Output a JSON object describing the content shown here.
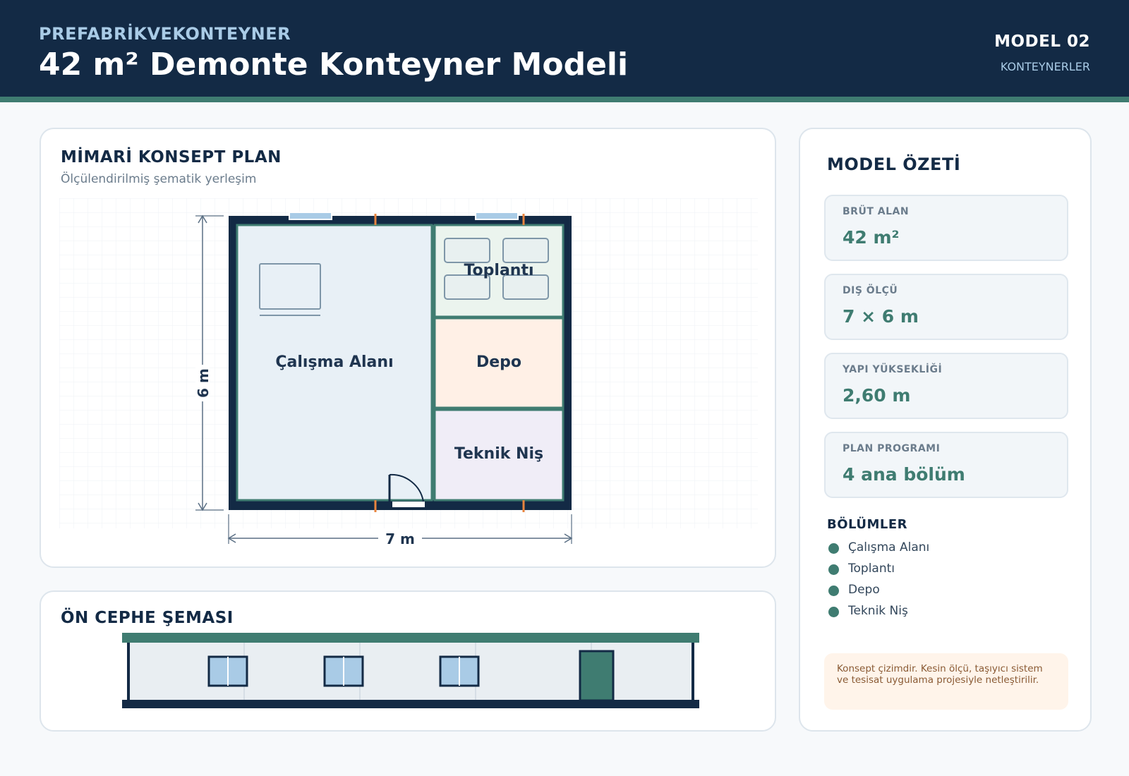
{
  "header": {
    "brand": "PREFABRİKVEKONTEYNER",
    "title": "42 m² Demonte Konteyner Modeli",
    "model_code": "MODEL 02",
    "category": "KONTEYNERLER"
  },
  "plan": {
    "title": "MİMARİ KONSEPT PLAN",
    "subtitle": "Ölçülendirilmiş şematik yerleşim",
    "width_label": "7 m",
    "height_label": "6 m",
    "rooms": {
      "work": "Çalışma Alanı",
      "meeting": "Toplantı",
      "storage": "Depo",
      "technical": "Teknik Niş"
    }
  },
  "front": {
    "title": "ÖN CEPHE ŞEMASI"
  },
  "summary": {
    "title": "MODEL ÖZETİ",
    "stats": [
      {
        "label": "BRÜT ALAN",
        "value": "42 m²"
      },
      {
        "label": "DIŞ ÖLÇÜ",
        "value": "7 × 6 m"
      },
      {
        "label": "YAPI YÜKSEKLİĞİ",
        "value": "2,60 m"
      },
      {
        "label": "PLAN PROGRAMI",
        "value": "4 ana bölüm"
      }
    ],
    "sections_title": "BÖLÜMLER",
    "sections": [
      "Çalışma Alanı",
      "Toplantı",
      "Depo",
      "Teknik Niş"
    ],
    "note": "Konsept çizimdir. Kesin ölçü, taşıyıcı sistem ve tesisat uygulama projesiyle netleştirilir."
  },
  "colors": {
    "navy": "#132a45",
    "teal": "#3f7c71",
    "work_room": "#e8f0f6",
    "meeting_room": "#ebf4ee",
    "storage_room": "#fff0e6",
    "technical_room": "#f0edf7",
    "accent_orange": "#e8843e"
  }
}
